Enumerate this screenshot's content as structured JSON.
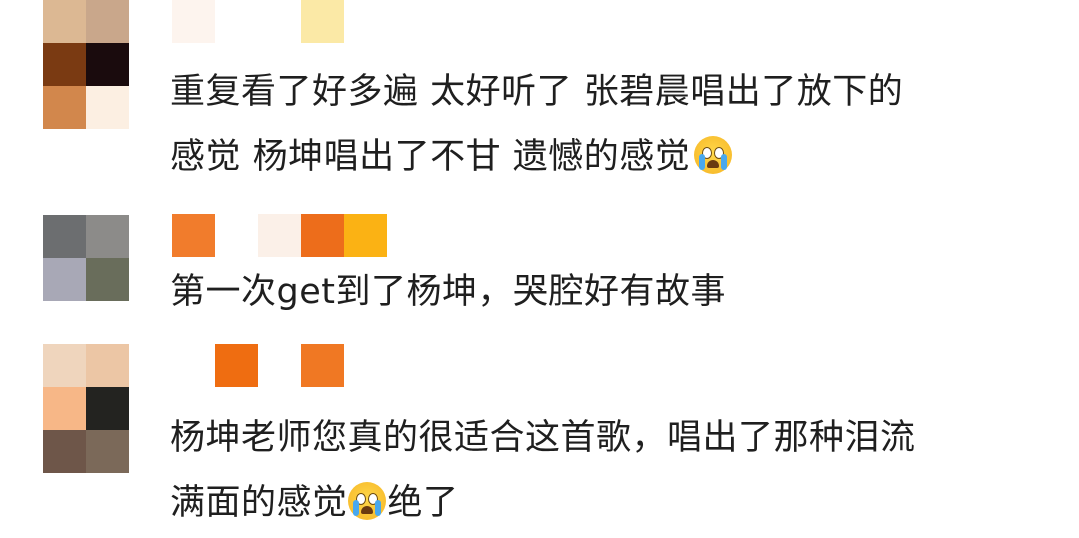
{
  "comments": [
    {
      "avatar_pixels": [
        "#dcb893",
        "#c9a78b",
        "#7a3a12",
        "#1a0b0d",
        "#d2874c",
        "#fcefe2"
      ],
      "name_blocks": [
        "#fdf4ee",
        "#fbe9a6"
      ],
      "text_line1": "重复看了好多遍 太好听了 张碧晨唱出了放下的",
      "text_line2": "感觉 杨坤唱出了不甘 遗憾的感觉",
      "emoji": "loudly-crying-face-icon"
    },
    {
      "avatar_pixels": [
        "#6c6e70",
        "#8c8b89",
        "#a8a8b6",
        "#696d5b"
      ],
      "name_blocks": [
        "#f17c2c",
        "#fbf0e8",
        "#ed6d1b",
        "#fbb214"
      ],
      "text_line1": "第一次get到了杨坤，哭腔好有故事"
    },
    {
      "avatar_pixels": [
        "#efd5bd",
        "#ecc6a5",
        "#f7b787",
        "#232320",
        "#6e5649",
        "#7b6959"
      ],
      "name_blocks": [
        "#ef6d11",
        "#f07823"
      ],
      "text_line1": "杨坤老师您真的很适合这首歌，唱出了那种泪流",
      "text_line2_a": "满面的感觉",
      "text_line2_b": "绝了",
      "emoji": "loudly-crying-face-icon"
    }
  ]
}
